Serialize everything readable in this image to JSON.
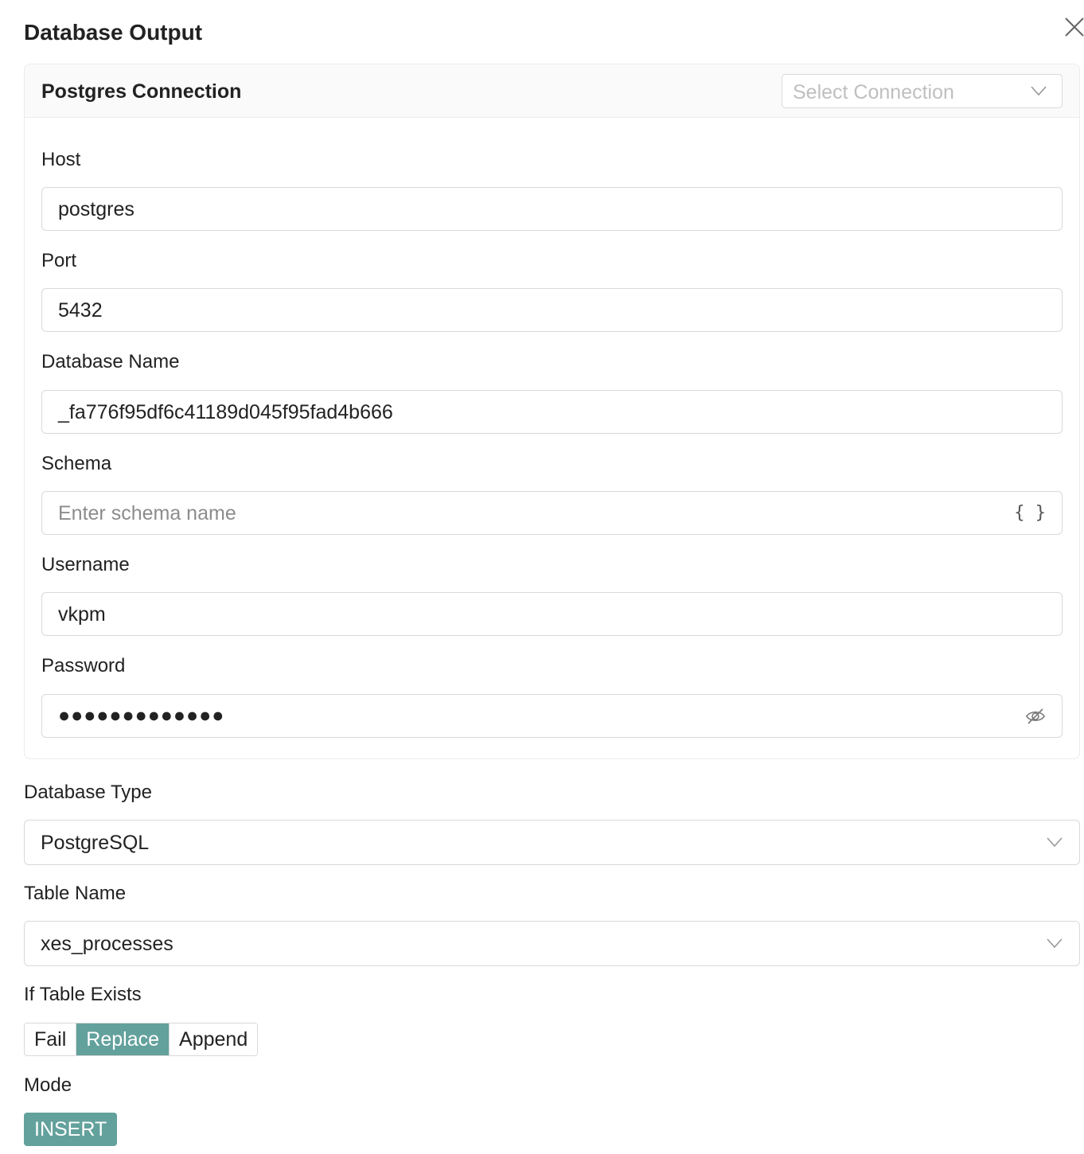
{
  "dialog": {
    "title": "Database Output",
    "close_icon": "close-icon"
  },
  "connection": {
    "title": "Postgres Connection",
    "select_placeholder": "Select Connection",
    "fields": {
      "host": {
        "label": "Host",
        "value": "postgres"
      },
      "port": {
        "label": "Port",
        "value": "5432"
      },
      "database_name": {
        "label": "Database Name",
        "value": "_fa776f95df6c41189d045f95fad4b666"
      },
      "schema": {
        "label": "Schema",
        "placeholder": "Enter schema name",
        "suffix": "{ }"
      },
      "username": {
        "label": "Username",
        "value": "vkpm"
      },
      "password": {
        "label": "Password",
        "value": "●●●●●●●●●●●●●",
        "icon": "eye-slash-icon"
      }
    }
  },
  "database_type": {
    "label": "Database Type",
    "value": "PostgreSQL"
  },
  "table_name": {
    "label": "Table Name",
    "value": "xes_processes"
  },
  "if_table_exists": {
    "label": "If Table Exists",
    "options": [
      "Fail",
      "Replace",
      "Append"
    ],
    "selected": "Replace"
  },
  "mode": {
    "label": "Mode",
    "value": "INSERT"
  },
  "colors": {
    "accent": "#63a19c",
    "border": "#d9d9d9",
    "placeholder": "#bfbfbf"
  }
}
